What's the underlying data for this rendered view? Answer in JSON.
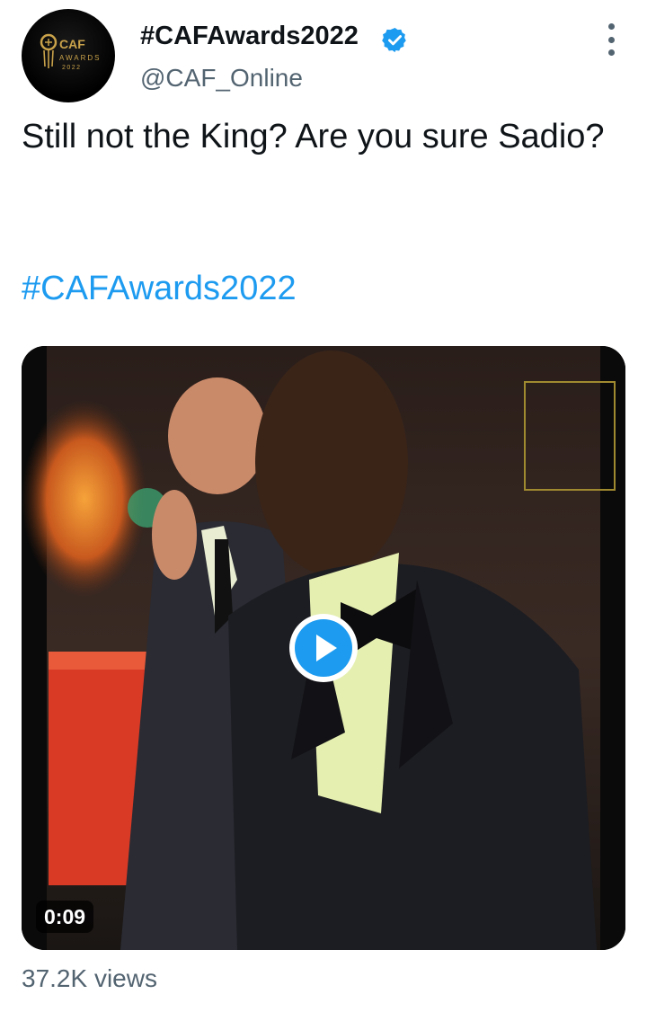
{
  "author": {
    "display_name": "#CAFAwards2022",
    "handle": "@CAF_Online",
    "verified": true,
    "avatar_logo_text": "CAF",
    "avatar_subtext": "AWARDS",
    "avatar_year": "2022"
  },
  "tweet": {
    "text": "Still not the King? Are you sure Sadio?",
    "hashtag": "#CAFAwards2022"
  },
  "media": {
    "type": "video",
    "duration": "0:09"
  },
  "stats": {
    "views": "37.2K views"
  },
  "colors": {
    "accent": "#1d9bf0",
    "text_primary": "#0f1419",
    "text_secondary": "#536471",
    "gold": "#c9a24a"
  },
  "icons": {
    "verified": "verified-badge-icon",
    "more": "more-options-icon",
    "play": "play-icon"
  }
}
